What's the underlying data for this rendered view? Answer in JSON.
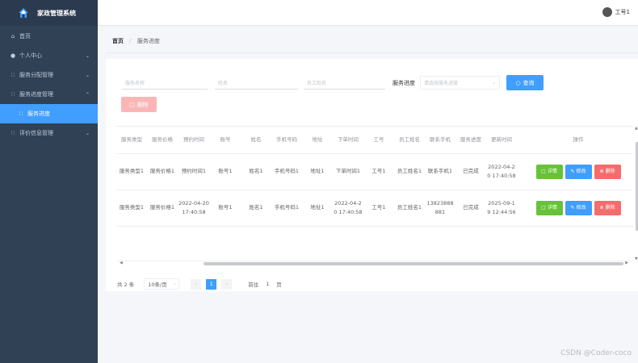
{
  "app": {
    "title": "家政管理系统"
  },
  "sidebar": {
    "items": [
      {
        "icon": "home-icon",
        "glyph": "⌂",
        "label": "首页"
      },
      {
        "icon": "user-icon",
        "glyph": "👤",
        "label": "个人中心",
        "arrow": "⌄"
      },
      {
        "icon": "grid-icon",
        "glyph": "▪",
        "label": "服务分配管理",
        "arrow": "⌄"
      },
      {
        "icon": "grid-icon",
        "glyph": "▪",
        "label": "服务进度管理",
        "arrow": "⌃"
      },
      {
        "icon": "grid-icon",
        "glyph": "▪",
        "label": "服务进度"
      },
      {
        "icon": "grid-icon",
        "glyph": "▪",
        "label": "评价信息管理",
        "arrow": "⌄"
      }
    ]
  },
  "header": {
    "user_name": "工号1"
  },
  "breadcrumb": {
    "home": "首页",
    "current": "服务进度",
    "separator": "/"
  },
  "search": {
    "service_name_placeholder": "服务名称",
    "name_placeholder": "姓名",
    "employee_name_placeholder": "员工姓名",
    "progress_label": "服务进度",
    "progress_placeholder": "请选择服务进度",
    "query_label": "查询",
    "delete_label": "删除"
  },
  "table": {
    "columns": [
      "服务类型",
      "服务价格",
      "预约时间",
      "账号",
      "姓名",
      "手机号码",
      "地址",
      "下单时间",
      "工号",
      "员工姓名",
      "联系手机",
      "服务进度",
      "更新时间",
      "操作"
    ],
    "rows": [
      [
        "服务类型1",
        "服务价格1",
        "预约时间1",
        "账号1",
        "姓名1",
        "手机号码1",
        "地址1",
        "下单时间1",
        "工号1",
        "员工姓名1",
        "联系手机1",
        "已完成",
        "2022-04-20 17:40:58"
      ],
      [
        "服务类型1",
        "服务价格1",
        "2022-04-20 17:40:58",
        "账号1",
        "姓名1",
        "手机号码1",
        "地址1",
        "2022-04-20 17:40:58",
        "工号1",
        "员工姓名1",
        "13823888881",
        "已完成",
        "2025-09-19 12:44:56"
      ]
    ],
    "actions": {
      "detail": "详情",
      "edit": "修改",
      "delete": "删除"
    }
  },
  "pagination": {
    "total_label": "共 2 条",
    "page_size": "10条/页",
    "prev": "‹",
    "current_page": "1",
    "next": "›",
    "goto_label": "前往",
    "goto_value": "1",
    "page_unit": "页"
  },
  "watermark": "CSDN @Coder-coco",
  "colors": {
    "sidebar": "#304156",
    "primary": "#409eff",
    "success": "#67c23a",
    "danger": "#f56c6c"
  }
}
